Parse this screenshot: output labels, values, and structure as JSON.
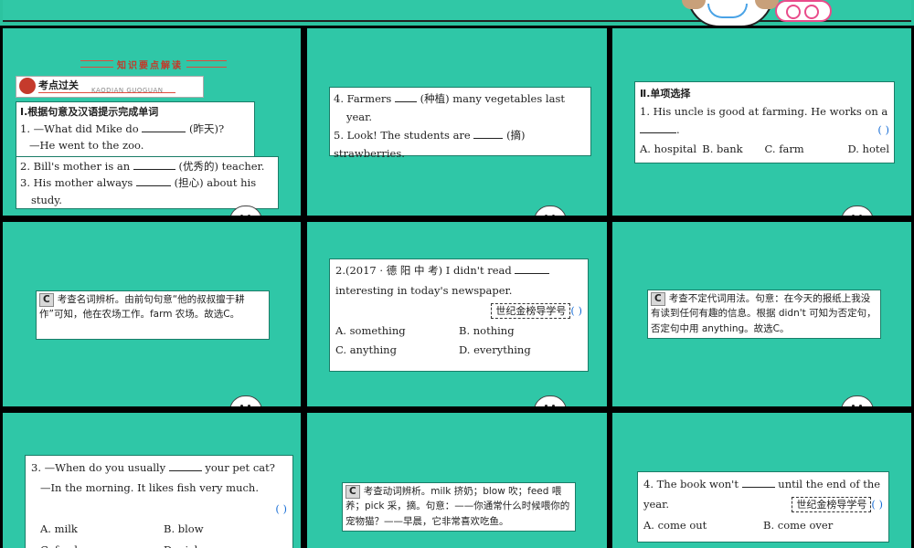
{
  "s1": {
    "section_title": "知识要点解读",
    "banner_zh": "考点过关",
    "banner_en": "KAODIAN GUOGUAN",
    "part_title": "Ⅰ.根据句意及汉语提示完成单词",
    "q1a": "1. —What did Mike do",
    "q1a_hint": "(昨天)?",
    "q1b": "—He went to the zoo.",
    "q2_pre": "2. Bill's mother is an",
    "q2_hint": "(优秀的) teacher.",
    "q3_pre": "3. His mother always",
    "q3_hint": "(担心) about his",
    "q3_end": "study."
  },
  "s2": {
    "q4_pre": "4. Farmers",
    "q4_hint": "(种植) many vegetables last",
    "q4_end": "year.",
    "q5_pre": "5. Look! The students are",
    "q5_hint": "(摘) strawberries."
  },
  "s3": {
    "part_title": "Ⅱ.单项选择",
    "q_text": "1. His uncle is good at farming. He works on a",
    "q_end": ".",
    "paren": "(      )",
    "options": [
      "A. hospital",
      "B. bank",
      "C. farm",
      "D. hotel"
    ]
  },
  "s4": {
    "badge": "C",
    "explanation": "考查名词辨析。由前句句意“他的叔叔擅于耕作”可知，他在农场工作。farm 农场。故选C。"
  },
  "s5": {
    "q_line1": "2.(2017 · 德 阳 中 考) I  didn't  read",
    "q_line2": "interesting in today's newspaper.",
    "tag": "世纪金榜导学号",
    "paren": "(      )",
    "options": [
      "A. something",
      "B. nothing",
      "C. anything",
      "D. everything"
    ]
  },
  "s6": {
    "badge": "C",
    "explanation": "考查不定代词用法。句意：在今天的报纸上我没有读到任何有趣的信息。根据 didn't 可知为否定句，否定句中用 anything。故选C。"
  },
  "s7": {
    "q_line1_pre": "3. —When do you usually",
    "q_line1_post": "your pet cat?",
    "q_line2": "—In the morning. It likes fish very much.",
    "paren": "(      )",
    "options": [
      "A. milk",
      "B. blow",
      "C. feed",
      "D. pick"
    ]
  },
  "s8": {
    "badge": "C",
    "explanation": "考查动词辨析。milk 挤奶；blow 吹；feed 喂养；pick 采，摘。句意：——你通常什么时候喂你的宠物猫？——早晨，它非常喜欢吃鱼。"
  },
  "s9": {
    "q_pre": "4. The  book  won't",
    "q_post": "until  the  end  of  the",
    "q_line2": "year.",
    "tag": "世纪金榜导学号",
    "paren": "(      )",
    "options": [
      "A. come out",
      "B. come over"
    ]
  }
}
